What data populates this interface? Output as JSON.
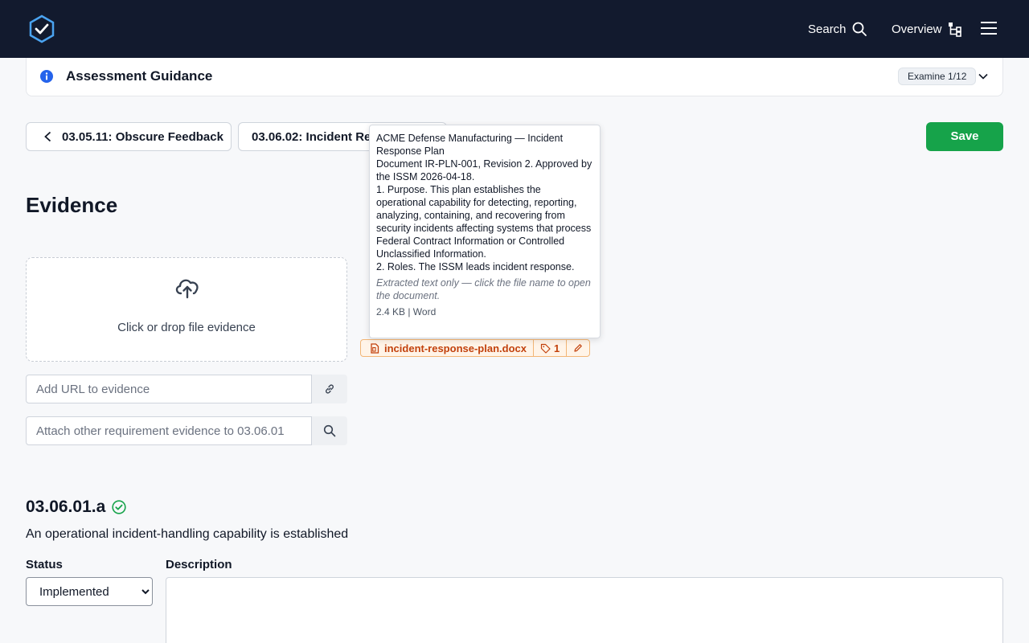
{
  "nav": {
    "search_label": "Search",
    "overview_label": "Overview"
  },
  "guidance": {
    "title": "Assessment Guidance",
    "badge": "Examine 1/12"
  },
  "requirement_nav": {
    "prev_label": "03.05.11: Obscure Feedback",
    "next_label": "03.06.02: Incident Re",
    "save_label": "Save"
  },
  "evidence": {
    "heading": "Evidence",
    "drop_text": "Click or drop file evidence",
    "url_placeholder": "Add URL to evidence",
    "attach_placeholder": "Attach other requirement evidence to 03.06.01"
  },
  "tooltip": {
    "lines": "ACME Defense Manufacturing — Incident Response Plan\nDocument IR-PLN-001, Revision 2. Approved by the ISSM 2026-04-18.\n1. Purpose. This plan establishes the operational capability for detecting, reporting, analyzing, containing, and recovering from security incidents affecting systems that process Federal Contract Information or Controlled Unclassified Information.\n2. Roles. The ISSM leads incident response.",
    "note": "Extracted text only — click the file name to open the document.",
    "meta": "2.4 KB | Word"
  },
  "file_chip": {
    "name": "incident-response-plan.docx",
    "tag_count": "1"
  },
  "requirement": {
    "id": "03.06.01.a",
    "description": "An operational incident-handling capability is established",
    "status_label": "Status",
    "status_value": "Implemented",
    "description_label": "Description"
  },
  "colors": {
    "topbar": "#121a2e",
    "accent_green": "#16a34a",
    "info_blue": "#2563eb",
    "chip_orange": "#c2410c"
  }
}
